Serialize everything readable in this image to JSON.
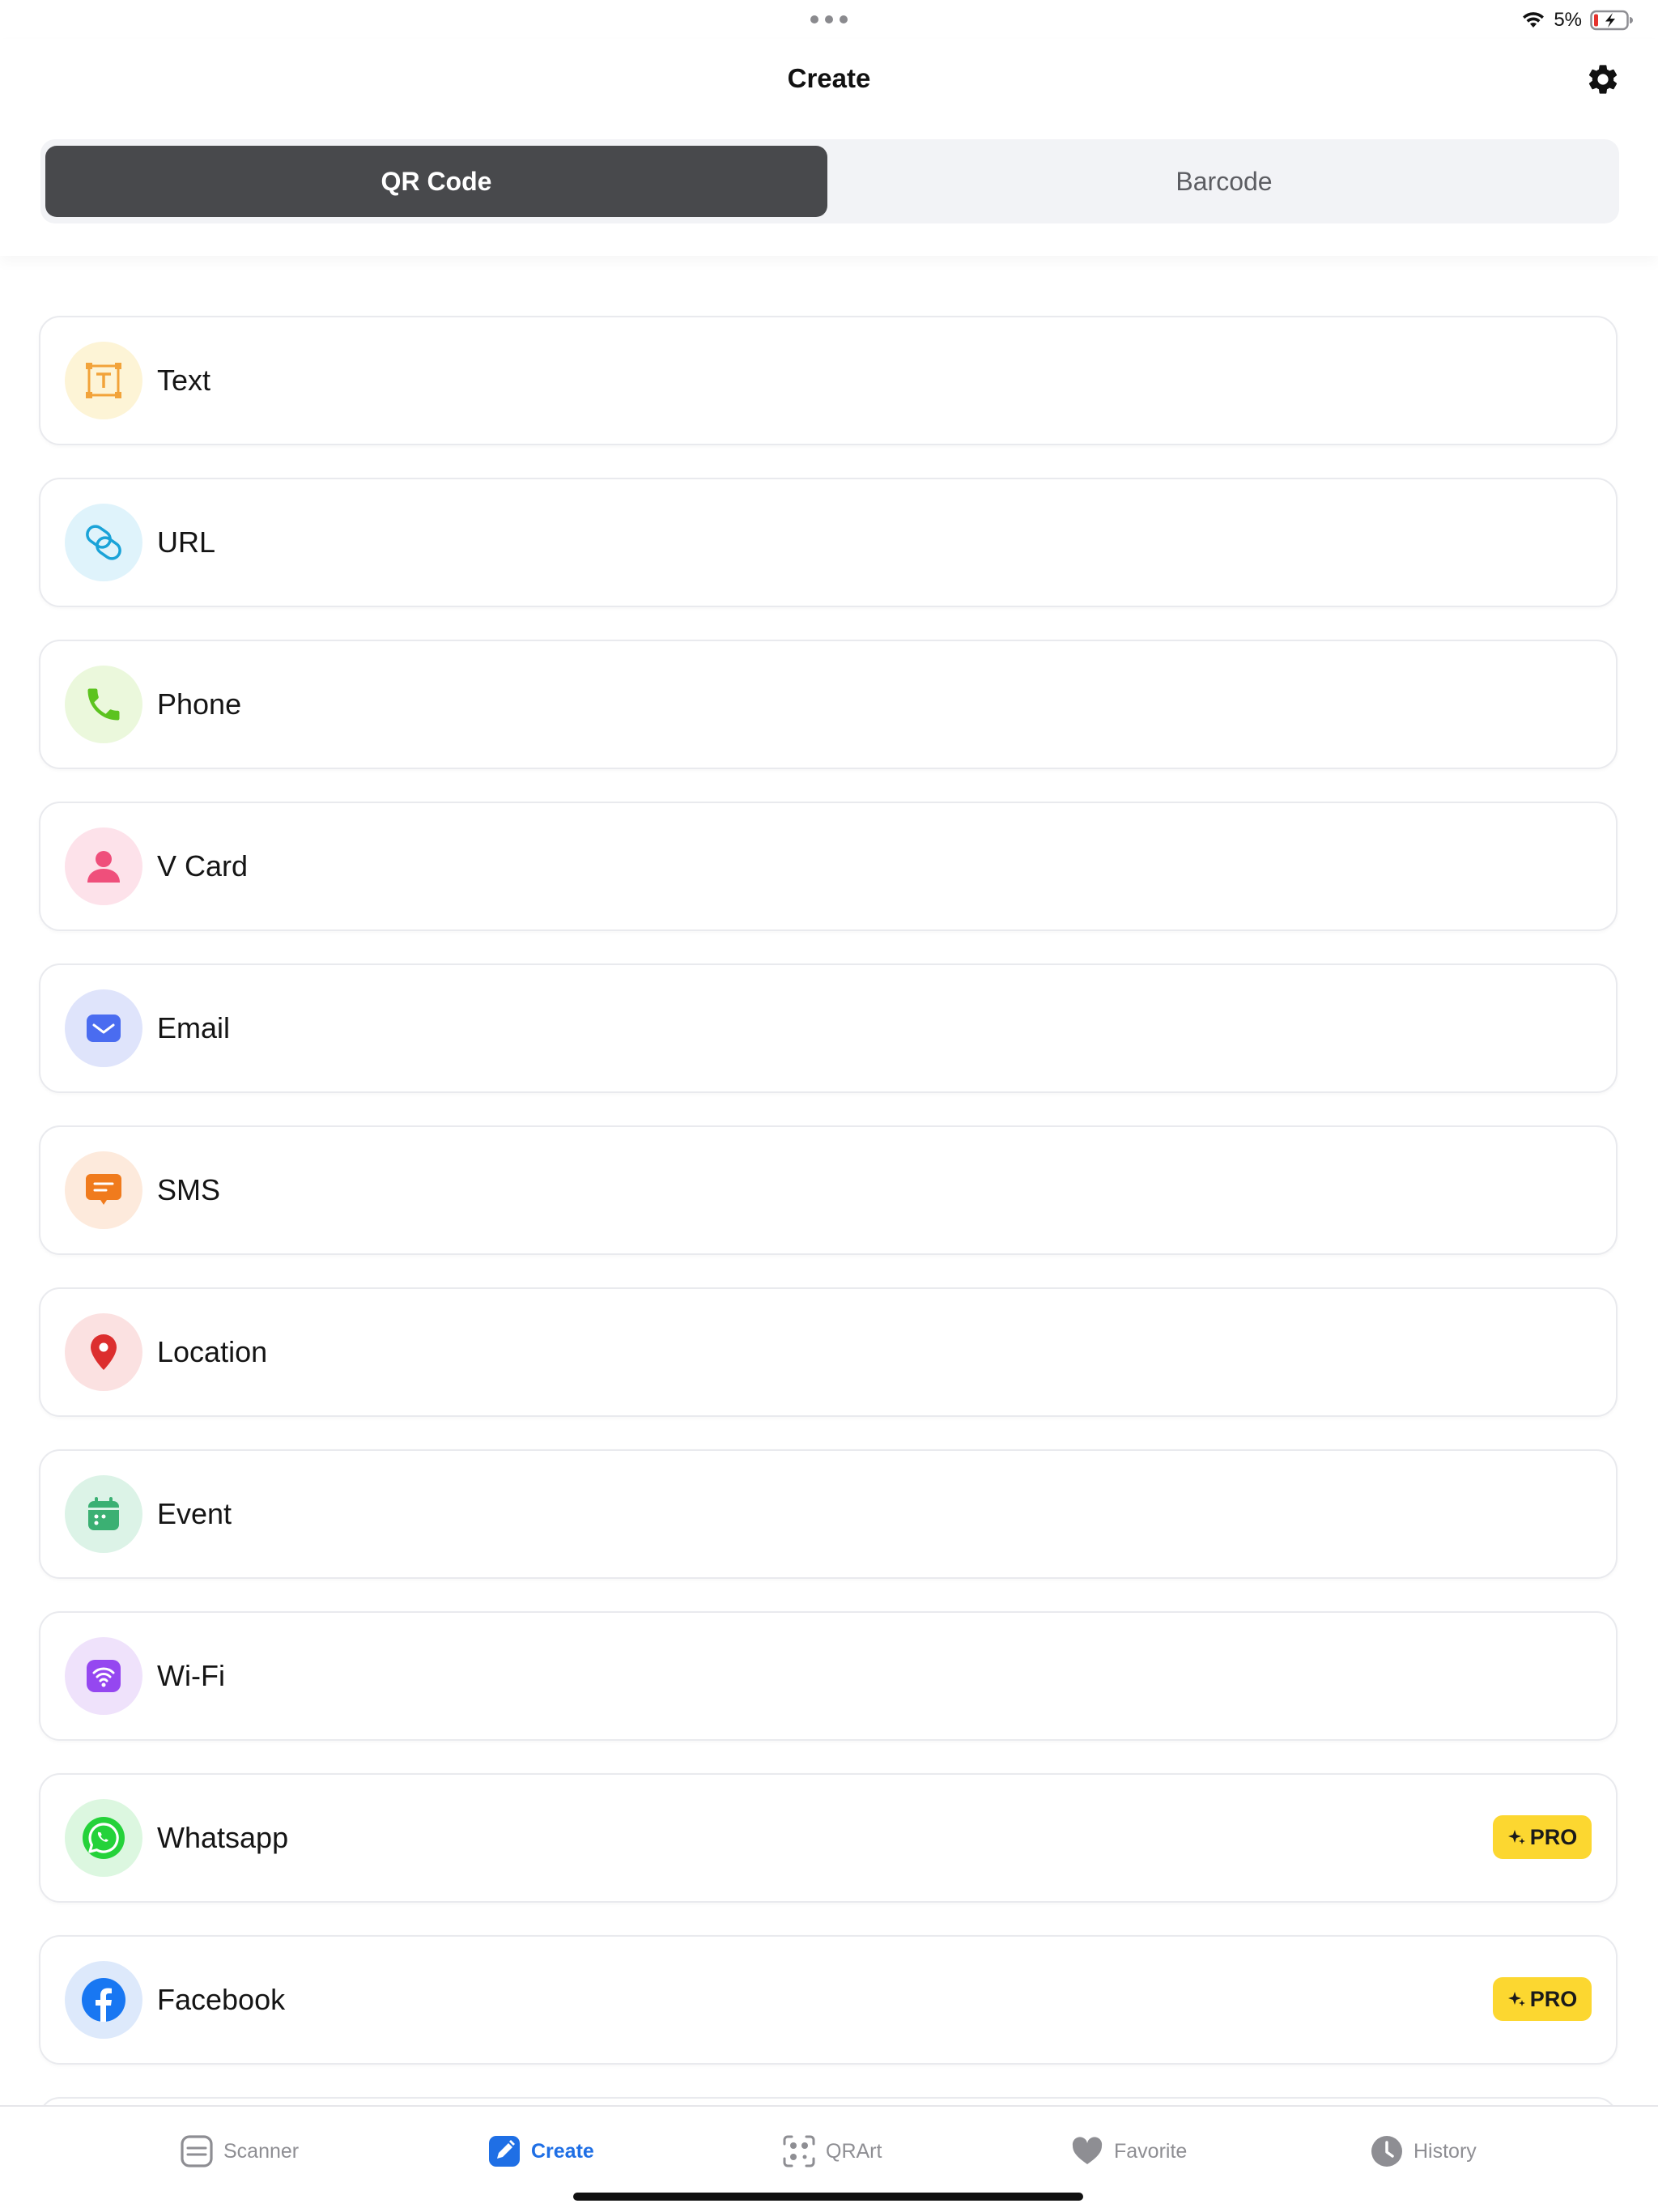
{
  "status_bar": {
    "battery_percent": "5%",
    "charging": true
  },
  "header": {
    "title": "Create",
    "settings_icon": "gear-icon"
  },
  "segments": {
    "qr_label": "QR Code",
    "barcode_label": "Barcode",
    "selected": "QR Code"
  },
  "items": [
    {
      "label": "Text",
      "icon": "text-icon",
      "pro": false,
      "accent": "#f2a33a"
    },
    {
      "label": "URL",
      "icon": "link-icon",
      "pro": false,
      "accent": "#1aa3d8"
    },
    {
      "label": "Phone",
      "icon": "phone-icon",
      "pro": false,
      "accent": "#5cc31f"
    },
    {
      "label": "V Card",
      "icon": "person-icon",
      "pro": false,
      "accent": "#ef4f7b"
    },
    {
      "label": "Email",
      "icon": "envelope-icon",
      "pro": false,
      "accent": "#4a6cf0"
    },
    {
      "label": "SMS",
      "icon": "message-icon",
      "pro": false,
      "accent": "#f07b1d"
    },
    {
      "label": "Location",
      "icon": "location-pin-icon",
      "pro": false,
      "accent": "#dc2e2e"
    },
    {
      "label": "Event",
      "icon": "calendar-icon",
      "pro": false,
      "accent": "#3bb073"
    },
    {
      "label": "Wi-Fi",
      "icon": "wifi-icon",
      "pro": false,
      "accent": "#9547f0"
    },
    {
      "label": "Whatsapp",
      "icon": "whatsapp-icon",
      "pro": true,
      "accent": "#25d23a"
    },
    {
      "label": "Facebook",
      "icon": "facebook-icon",
      "pro": true,
      "accent": "#1877f2"
    }
  ],
  "pro_badge_label": "PRO",
  "tab_bar": {
    "tabs": [
      {
        "label": "Scanner",
        "icon": "scanner-icon",
        "active": false
      },
      {
        "label": "Create",
        "icon": "create-edit-icon",
        "active": true
      },
      {
        "label": "QRArt",
        "icon": "qrart-icon",
        "active": false
      },
      {
        "label": "Favorite",
        "icon": "heart-icon",
        "active": false
      },
      {
        "label": "History",
        "icon": "clock-icon",
        "active": false
      }
    ]
  }
}
